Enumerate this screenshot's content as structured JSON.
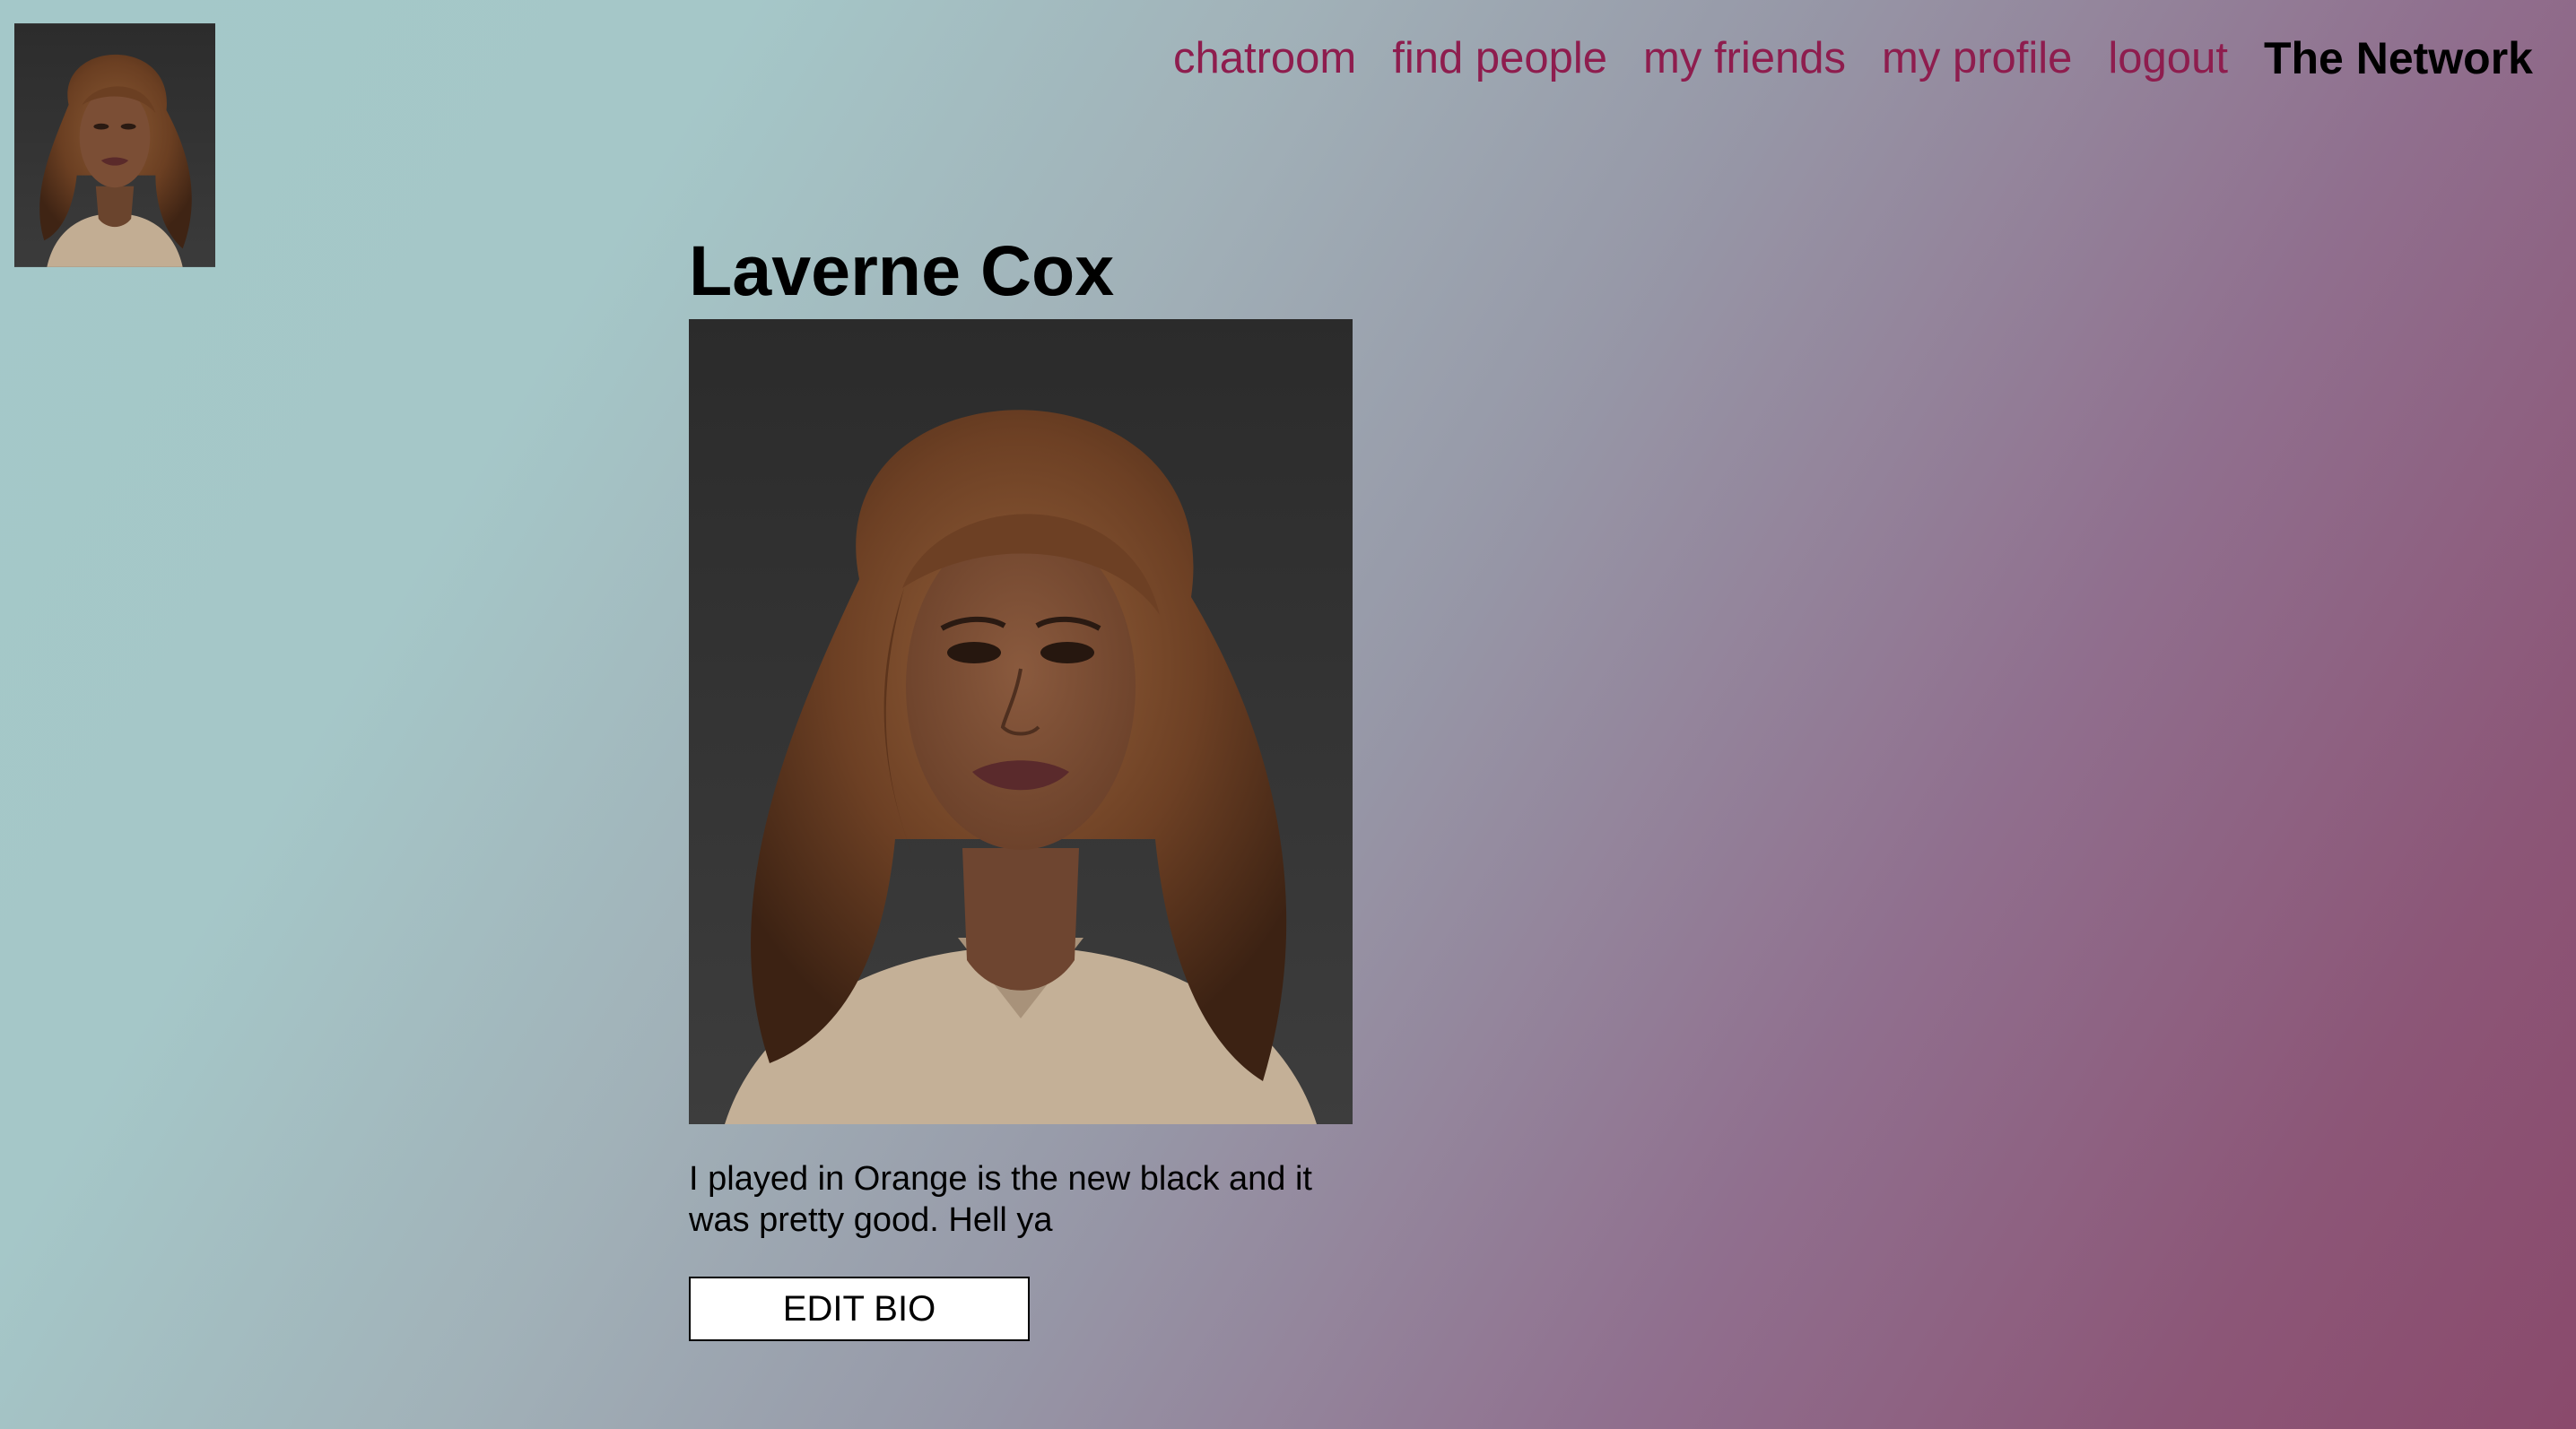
{
  "nav": {
    "links": [
      {
        "label": "chatroom"
      },
      {
        "label": "find people"
      },
      {
        "label": "my friends"
      },
      {
        "label": "my profile"
      },
      {
        "label": "logout"
      }
    ],
    "brand": "The Network",
    "link_color": "#8e1d4e"
  },
  "avatar": {
    "icon": "user-portrait-thumbnail"
  },
  "profile": {
    "name": "Laverne Cox",
    "photo_icon": "profile-portrait",
    "bio": "I played in Orange is the new black and it was pretty good. Hell ya",
    "edit_button_label": "EDIT BIO"
  }
}
